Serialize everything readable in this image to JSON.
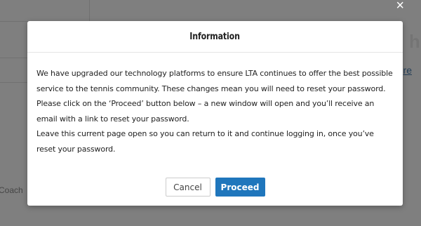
{
  "background": {
    "heading_fragment": "hi",
    "link_fragment": "re",
    "side_label_fragment": "Coach"
  },
  "modal": {
    "close_glyph": "×",
    "title": "Information",
    "paragraphs": [
      "We have upgraded our technology platforms to ensure LTA continues to offer the best possible service to the tennis community. These changes mean you will need to reset your password.",
      "Please click on the ‘Proceed’ button below – a new window will open and you’ll receive an email with a link to reset your password.",
      "Leave this current page open so you can return to it and continue logging in, once you’ve reset your password."
    ],
    "cancel_label": "Cancel",
    "proceed_label": "Proceed"
  },
  "colors": {
    "primary_button": "#1f76bc",
    "overlay": "rgba(0,0,0,0.5)"
  }
}
